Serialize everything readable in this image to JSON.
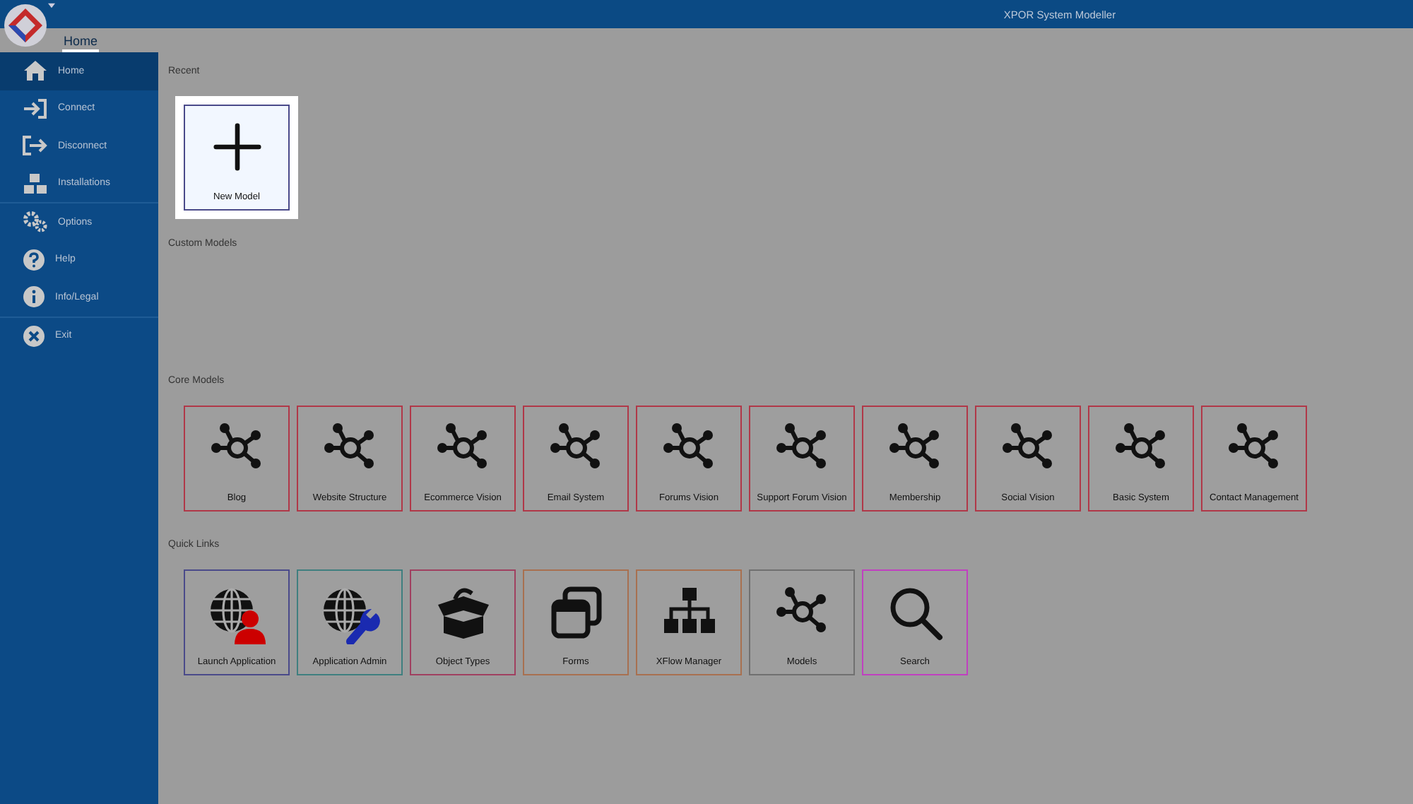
{
  "window": {
    "title": "XPOR System Modeller"
  },
  "tabs": [
    {
      "label": "Home",
      "selected": true
    }
  ],
  "sidebar": {
    "groups": [
      [
        {
          "label": "Home",
          "kind": "home",
          "selected": true
        },
        {
          "label": "Connect",
          "kind": "connect",
          "selected": false
        },
        {
          "label": "Disconnect",
          "kind": "disconnect",
          "selected": false
        },
        {
          "label": "Installations",
          "kind": "installations",
          "selected": false
        }
      ],
      [
        {
          "label": "Options",
          "kind": "options",
          "selected": false
        },
        {
          "label": "Help",
          "kind": "help",
          "selected": false
        },
        {
          "label": "Info/Legal",
          "kind": "info",
          "selected": false
        }
      ],
      [
        {
          "label": "Exit",
          "kind": "exit",
          "selected": false
        }
      ]
    ]
  },
  "recent": {
    "title": "Recent",
    "tiles": [
      {
        "label": "New Model",
        "color": "#4a4a8a"
      }
    ]
  },
  "custom_models": {
    "title": "Custom Models"
  },
  "core_models": {
    "title": "Core Models",
    "tiles": [
      {
        "label": "Blog",
        "color": "#b03848"
      },
      {
        "label": "Website Structure",
        "color": "#b03848"
      },
      {
        "label": "Ecommerce Vision",
        "color": "#b03848"
      },
      {
        "label": "Email System",
        "color": "#b03848"
      },
      {
        "label": "Forums Vision",
        "color": "#b03848"
      },
      {
        "label": "Support Forum Vision",
        "color": "#b03848"
      },
      {
        "label": "Membership",
        "color": "#b03848"
      },
      {
        "label": "Social Vision",
        "color": "#b03848"
      },
      {
        "label": "Basic System",
        "color": "#b03848"
      },
      {
        "label": "Contact Management",
        "color": "#b03848"
      }
    ]
  },
  "quick_links": {
    "title": "Quick Links",
    "tiles": [
      {
        "label": "Launch Application",
        "kind": "globe-user",
        "color": "#4a4a8a"
      },
      {
        "label": "Application Admin",
        "kind": "globe-wrench",
        "color": "#3f7f7f"
      },
      {
        "label": "Object Types",
        "kind": "box",
        "color": "#a04060"
      },
      {
        "label": "Forms",
        "kind": "windows",
        "color": "#a87050"
      },
      {
        "label": "XFlow Manager",
        "kind": "hierarchy",
        "color": "#a87050"
      },
      {
        "label": "Models",
        "kind": "network",
        "color": "#707070"
      },
      {
        "label": "Search",
        "kind": "search",
        "color": "#c040c0"
      }
    ]
  }
}
